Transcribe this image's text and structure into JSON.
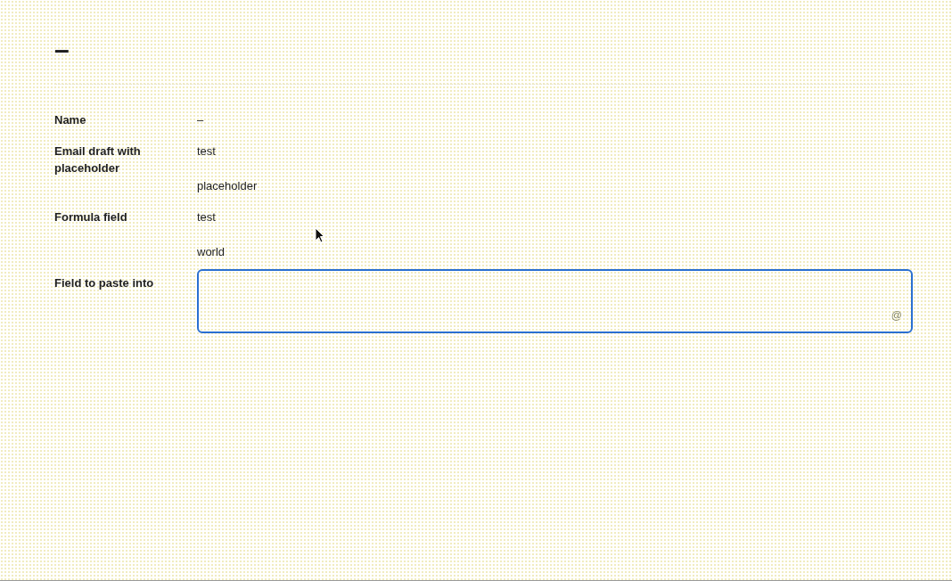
{
  "title": "–",
  "fields": [
    {
      "label": "Name",
      "kind": "text",
      "values": [
        "–"
      ]
    },
    {
      "label": "Email draft with placeholder",
      "kind": "text",
      "values": [
        "test",
        "placeholder"
      ]
    },
    {
      "label": "Formula field",
      "kind": "text",
      "values": [
        "test",
        "world"
      ]
    },
    {
      "label": "Field to paste into",
      "kind": "input",
      "focused": true,
      "mention_symbol": "@"
    }
  ]
}
